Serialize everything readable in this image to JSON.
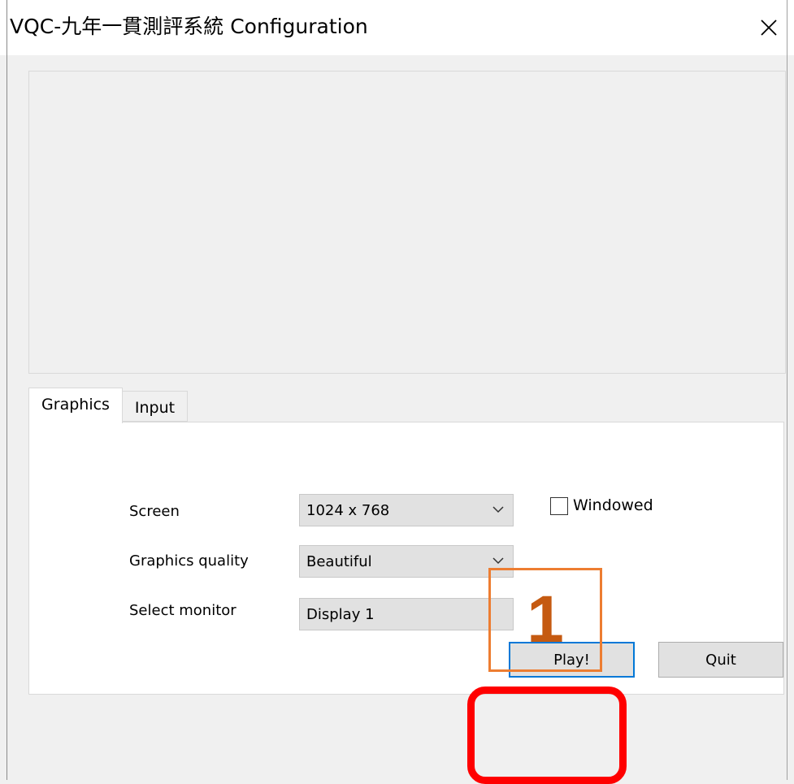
{
  "window": {
    "title": "VQC-九年一貫測評系統 Configuration",
    "close_icon": "close-icon"
  },
  "tabs": [
    {
      "label": "Graphics",
      "active": true
    },
    {
      "label": "Input",
      "active": false
    }
  ],
  "graphics": {
    "screen_label": "Screen",
    "screen_value": "1024 x 768",
    "quality_label": "Graphics quality",
    "quality_value": "Beautiful",
    "monitor_label": "Select monitor",
    "monitor_value": "Display 1",
    "windowed_label": "Windowed",
    "windowed_checked": false
  },
  "buttons": {
    "play": "Play!",
    "quit": "Quit"
  },
  "annotation": {
    "step_number": "1",
    "box_color": "#ed7d31",
    "number_color": "#c55a11",
    "highlight_color": "#ff0000"
  }
}
